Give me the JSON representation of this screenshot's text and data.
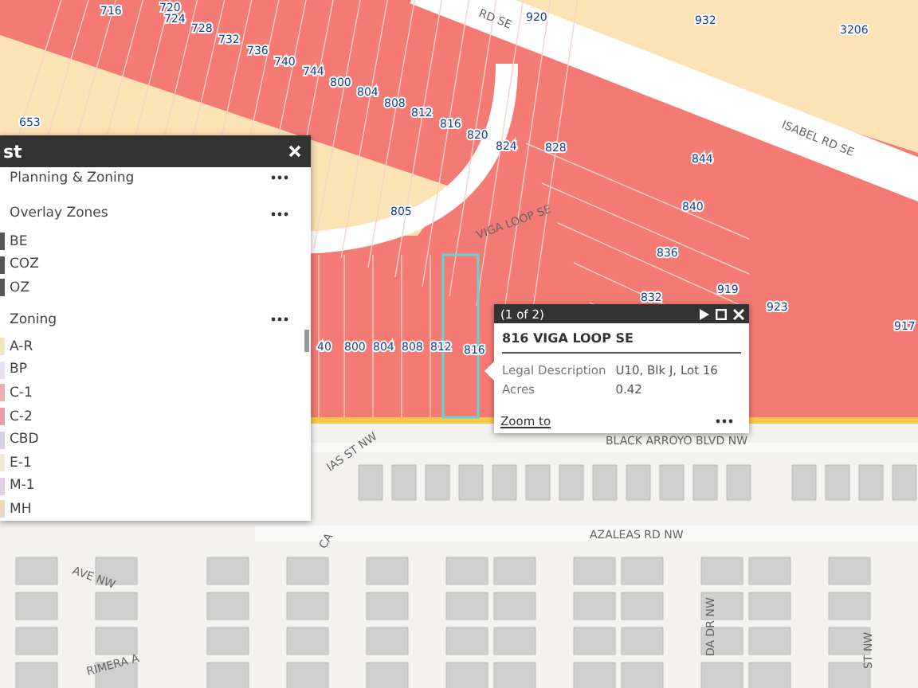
{
  "map": {
    "parcel_labels": [
      "716",
      "720",
      "724",
      "728",
      "732",
      "736",
      "740",
      "744",
      "800",
      "804",
      "808",
      "812",
      "816",
      "820",
      "824",
      "828",
      "920",
      "932",
      "3206",
      "844",
      "840",
      "836",
      "832",
      "919",
      "923",
      "917",
      "805",
      "653",
      "40",
      "800",
      "804",
      "808",
      "812",
      "816"
    ],
    "street_labels": [
      "RD SE",
      "ISABEL RD SE",
      "VIGA LOOP SE",
      "BLACK ARROYO BLVD NW",
      "IAS ST NW",
      "CA",
      "AVE NW",
      "AZALEAS RD NW",
      "RIMERA A",
      "DA DR NW",
      "ST NW"
    ]
  },
  "layer_list": {
    "title": "st",
    "items": [
      {
        "kind": "group",
        "label": "Planning & Zoning"
      },
      {
        "kind": "group",
        "label": "Overlay Zones"
      },
      {
        "kind": "legend",
        "label": "BE",
        "color": "#555555"
      },
      {
        "kind": "legend",
        "label": "COZ",
        "color": "#555555"
      },
      {
        "kind": "legend",
        "label": "OZ",
        "color": "#555555"
      },
      {
        "kind": "group",
        "label": "Zoning"
      },
      {
        "kind": "legend",
        "label": "A-R",
        "color": "#f3e3c0"
      },
      {
        "kind": "legend",
        "label": "BP",
        "color": "#e8e0f0"
      },
      {
        "kind": "legend",
        "label": "C-1",
        "color": "#f0b0b0"
      },
      {
        "kind": "legend",
        "label": "C-2",
        "color": "#e8a0a8"
      },
      {
        "kind": "legend",
        "label": "CBD",
        "color": "#d8d0e8"
      },
      {
        "kind": "legend",
        "label": "E-1",
        "color": "#f0e8d0"
      },
      {
        "kind": "legend",
        "label": "M-1",
        "color": "#e0d0e8"
      },
      {
        "kind": "legend",
        "label": "MH",
        "color": "#f0d8c0"
      }
    ]
  },
  "popup": {
    "counter": "(1 of 2)",
    "title": "816 VIGA LOOP SE",
    "fields": [
      {
        "label": "Legal Description",
        "value": "U10, Blk J, Lot 16"
      },
      {
        "label": "Acres",
        "value": "0.42"
      }
    ],
    "link": "Zoom to"
  }
}
